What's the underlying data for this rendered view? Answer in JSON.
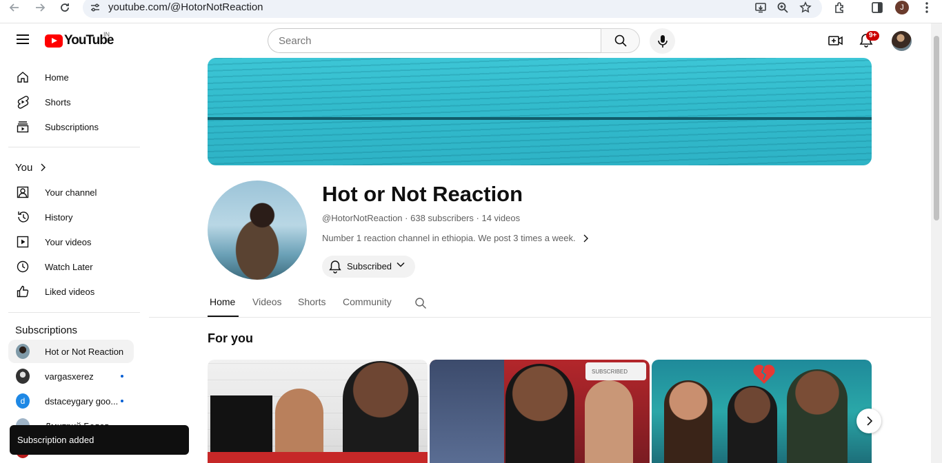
{
  "browser": {
    "url": "youtube.com/@HotorNotReaction",
    "profile_initial": "J"
  },
  "masthead": {
    "logo_text": "YouTube",
    "country_code": "IN",
    "search_placeholder": "Search",
    "notification_count": "9+"
  },
  "sidebar": {
    "main": [
      {
        "label": "Home",
        "icon": "home-icon"
      },
      {
        "label": "Shorts",
        "icon": "shorts-icon"
      },
      {
        "label": "Subscriptions",
        "icon": "subscriptions-icon"
      }
    ],
    "you_heading": "You",
    "you": [
      {
        "label": "Your channel",
        "icon": "your-channel-icon"
      },
      {
        "label": "History",
        "icon": "history-icon"
      },
      {
        "label": "Your videos",
        "icon": "your-videos-icon"
      },
      {
        "label": "Watch Later",
        "icon": "watch-later-icon"
      },
      {
        "label": "Liked videos",
        "icon": "liked-videos-icon"
      }
    ],
    "subscriptions_heading": "Subscriptions",
    "subscriptions": [
      {
        "name": "Hot or Not Reaction",
        "new": false,
        "active": true
      },
      {
        "name": "vargasxerez",
        "new": true
      },
      {
        "name": "dstaceygary goo...",
        "new": true,
        "initial": "d"
      },
      {
        "name": "Дмитрий Белов",
        "new": false
      },
      {
        "name": "...",
        "new": false
      }
    ]
  },
  "channel": {
    "name": "Hot or Not Reaction",
    "handle": "@HotorNotReaction",
    "subscribers": "638 subscribers",
    "videos": "14 videos",
    "description": "Number 1 reaction channel in ethiopia. We post 3 times a week.",
    "subscribe_label": "Subscribed",
    "tabs": [
      "Home",
      "Videos",
      "Shorts",
      "Community"
    ],
    "active_tab": "Home",
    "section_title": "For you",
    "thumbnail_badge": "SUBSCRIBED"
  },
  "toast": {
    "message": "Subscription added"
  },
  "colors": {
    "brand_red": "#ff0000",
    "link_blue": "#065fd4",
    "banner_teal": "#33bccd"
  }
}
